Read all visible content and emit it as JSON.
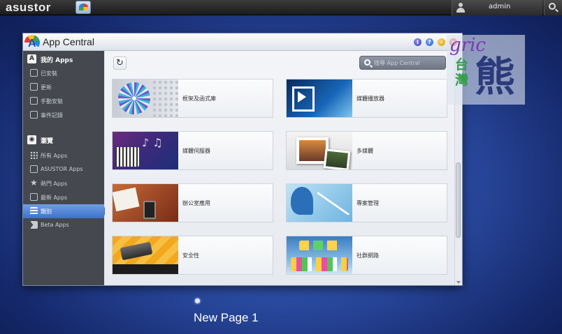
{
  "topbar": {
    "brand": "asustor",
    "user": "admin"
  },
  "window": {
    "title": "App Central"
  },
  "sidebar": {
    "sections": [
      {
        "label": "我的 Apps",
        "items": [
          "已安裝",
          "更新",
          "手動安裝",
          "事件記錄"
        ]
      },
      {
        "label": "瀏覽",
        "items": [
          "所有 Apps",
          "ASUSTOR Apps",
          "熱門 Apps",
          "最新 Apps",
          "類別",
          "Beta Apps"
        ]
      }
    ],
    "active_item": "類別"
  },
  "search": {
    "placeholder": "搜尋 App Central"
  },
  "categories": [
    {
      "label": "框架及函式庫",
      "icon": "framework-thumb"
    },
    {
      "label": "媒體播放器",
      "icon": "media-player-thumb"
    },
    {
      "label": "媒體伺服器",
      "icon": "media-server-thumb"
    },
    {
      "label": "多媒體",
      "icon": "multimedia-thumb"
    },
    {
      "label": "辦公室應用",
      "icon": "office-thumb"
    },
    {
      "label": "專案管理",
      "icon": "project-management-thumb"
    },
    {
      "label": "安全性",
      "icon": "security-thumb"
    },
    {
      "label": "社群網路",
      "icon": "social-network-thumb"
    }
  ],
  "watermark": {
    "top": "gric",
    "left": "台灣",
    "right": "熊"
  },
  "desktop": {
    "page_label": "New Page 1"
  }
}
